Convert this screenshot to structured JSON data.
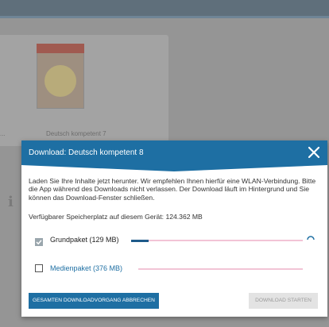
{
  "background": {
    "card_label": "Deutsch kompetent 7",
    "side_label": "...",
    "info_glyph": "i"
  },
  "dialog": {
    "title": "Download: Deutsch kompetent 8",
    "close_icon": "close-icon",
    "description": "Laden Sie Ihre Inhalte jetzt herunter. Wir empfehlen Ihnen hierfür eine WLAN-Verbindung. Bitte die App während des Downloads nicht verlassen. Der Download läuft im Hintergrund und Sie können das Download-Fenster schließen.",
    "storage": "Verfügbarer Speicherplatz auf diesem Gerät: 124.362 MB",
    "packages": [
      {
        "label": "Grundpaket (129 MB)",
        "checked": true,
        "progress": 0.1
      },
      {
        "label": "Medienpaket (376 MB)",
        "checked": false,
        "progress": 0
      }
    ],
    "cancel_button": "GESAMTEN DOWNLOADVORGANG ABBRECHEN",
    "start_button": "DOWNLOAD STARTEN",
    "colors": {
      "header": "#1e6fa3",
      "progress_fill": "#1e5a8a",
      "progress_track": "#f2c4d6",
      "disabled_button": "#e3e3e3"
    }
  }
}
